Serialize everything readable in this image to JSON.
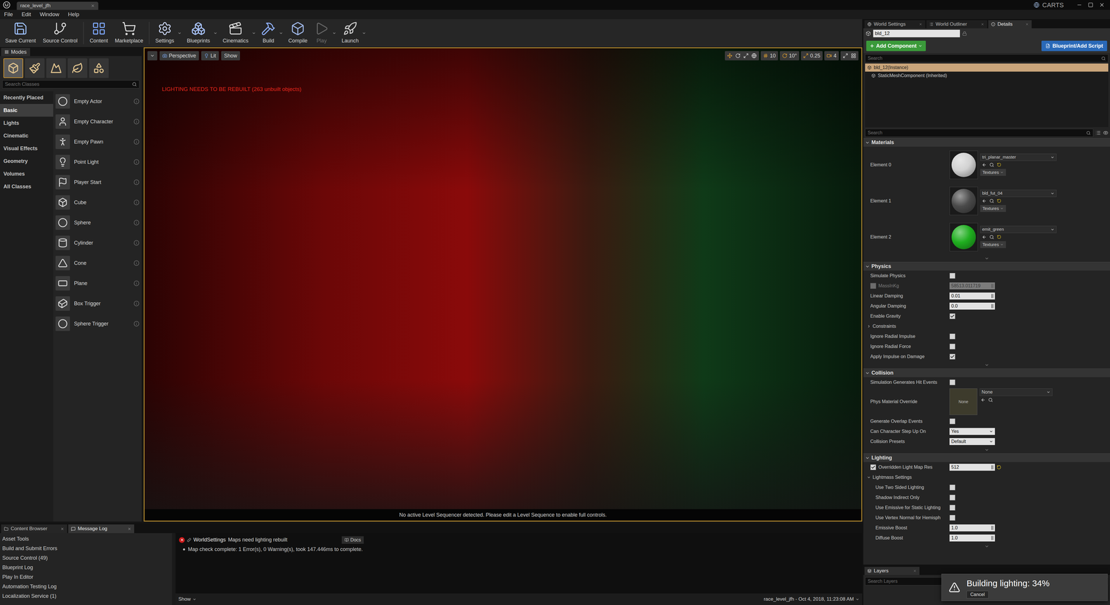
{
  "window": {
    "title": "race_level_jfh",
    "project": "CARTS"
  },
  "menu": [
    "File",
    "Edit",
    "Window",
    "Help"
  ],
  "toolbar": [
    {
      "label": "Save Current",
      "dropdown": false,
      "disabled": false,
      "separator_before": false
    },
    {
      "label": "Source Control",
      "dropdown": false,
      "disabled": false,
      "separator_before": false
    },
    {
      "label": "Content",
      "dropdown": false,
      "disabled": false,
      "separator_before": true
    },
    {
      "label": "Marketplace",
      "dropdown": false,
      "disabled": false,
      "separator_before": false
    },
    {
      "label": "Settings",
      "dropdown": true,
      "disabled": false,
      "separator_before": true
    },
    {
      "label": "Blueprints",
      "dropdown": true,
      "disabled": false,
      "separator_before": false
    },
    {
      "label": "Cinematics",
      "dropdown": true,
      "disabled": false,
      "separator_before": false
    },
    {
      "label": "Build",
      "dropdown": true,
      "disabled": false,
      "separator_before": false
    },
    {
      "label": "Compile",
      "dropdown": false,
      "disabled": false,
      "separator_before": false
    },
    {
      "label": "Play",
      "dropdown": true,
      "disabled": true,
      "separator_before": false
    },
    {
      "label": "Launch",
      "dropdown": true,
      "disabled": false,
      "separator_before": false
    }
  ],
  "modes": {
    "tab": "Modes",
    "tools": [
      {
        "selected": true
      },
      {
        "selected": false
      },
      {
        "selected": false
      },
      {
        "selected": false
      },
      {
        "selected": false
      }
    ],
    "search": {
      "placeholder": "Search Classes"
    },
    "categories": [
      {
        "label": "Recently Placed",
        "selected": false
      },
      {
        "label": "Basic",
        "selected": true
      },
      {
        "label": "Lights",
        "selected": false
      },
      {
        "label": "Cinematic",
        "selected": false
      },
      {
        "label": "Visual Effects",
        "selected": false
      },
      {
        "label": "Geometry",
        "selected": false
      },
      {
        "label": "Volumes",
        "selected": false
      },
      {
        "label": "All Classes",
        "selected": false
      }
    ],
    "items": [
      "Empty Actor",
      "Empty Character",
      "Empty Pawn",
      "Point Light",
      "Player Start",
      "Cube",
      "Sphere",
      "Cylinder",
      "Cone",
      "Plane",
      "Box Trigger",
      "Sphere Trigger"
    ]
  },
  "viewport": {
    "view": "Perspective",
    "lighting": "Lit",
    "show": "Show",
    "snap": [
      "10",
      "10°",
      "0.25",
      "4"
    ],
    "warning": "LIGHTING NEEDS TO BE REBUILT (263 unbuilt objects)",
    "footer": "No active Level Sequencer detected. Please edit a Level Sequence to enable full controls."
  },
  "bottom": {
    "tabs": [
      {
        "label": "Content Browser",
        "selected": false
      },
      {
        "label": "Message Log",
        "selected": true
      }
    ],
    "sources": [
      "Asset Tools",
      "Build and Submit Errors",
      "Source Control (49)",
      "Blueprint Log",
      "Play In Editor",
      "Automation Testing Log",
      "Localization Service (1)"
    ],
    "messages": [
      {
        "kind": "error",
        "source": "WorldSettings",
        "text": "Maps need lighting rebuilt",
        "docs": "Docs"
      },
      {
        "kind": "info",
        "source": "",
        "text": "Map check complete: 1 Error(s), 0 Warning(s), took 147.446ms to complete.",
        "docs": ""
      }
    ],
    "show": "Show",
    "status": "race_level_jfh - Oct 4, 2018, 11:23:08 AM"
  },
  "details": {
    "tabs": [
      {
        "label": "World Settings",
        "selected": false
      },
      {
        "label": "World Outliner",
        "selected": false
      },
      {
        "label": "Details",
        "selected": true
      }
    ],
    "name": "bld_12",
    "add_component": "Add Component",
    "blueprint": "Blueprint/Add Script",
    "component_search": {
      "placeholder": "Search"
    },
    "components": [
      {
        "label": "bld_12(Instance)",
        "selected": true
      },
      {
        "label": "StaticMeshComponent (Inherited)",
        "selected": false
      }
    ],
    "property_search": {
      "placeholder": "Search"
    },
    "materials": {
      "title": "Materials",
      "elements": [
        {
          "label": "Element 0",
          "material": "tri_planar_master",
          "textures": "Textures",
          "color": "#d2d2d2",
          "modified": true
        },
        {
          "label": "Element 1",
          "material": "bld_fut_04",
          "textures": "Textures",
          "color": "#4a4a4a",
          "modified": true
        },
        {
          "label": "Element 2",
          "material": "emit_green",
          "textures": "Textures",
          "color": "#1fae1f",
          "modified": true
        }
      ]
    },
    "sections": [
      {
        "title": "Physics",
        "rows": [
          {
            "kind": "check",
            "label": "Simulate Physics",
            "checked": false,
            "nested": false
          },
          {
            "kind": "number",
            "label": "MassInKg",
            "value": "58513.011719",
            "disabled": true,
            "has_check": true,
            "checked": false,
            "modified": false,
            "nested": false
          },
          {
            "kind": "number",
            "label": "Linear Damping",
            "value": "0.01",
            "disabled": false,
            "has_check": false,
            "checked": false,
            "modified": false,
            "nested": false
          },
          {
            "kind": "number",
            "label": "Angular Damping",
            "value": "0.0",
            "disabled": false,
            "has_check": false,
            "checked": false,
            "modified": false,
            "nested": false
          },
          {
            "kind": "check",
            "label": "Enable Gravity",
            "checked": true,
            "nested": false
          },
          {
            "kind": "group",
            "label": "Constraints",
            "expanded": false
          },
          {
            "kind": "check",
            "label": "Ignore Radial Impulse",
            "checked": false,
            "nested": false
          },
          {
            "kind": "check",
            "label": "Ignore Radial Force",
            "checked": false,
            "nested": false
          },
          {
            "kind": "check",
            "label": "Apply Impulse on Damage",
            "checked": true,
            "nested": false
          }
        ]
      },
      {
        "title": "Collision",
        "rows": [
          {
            "kind": "check",
            "label": "Simulation Generates Hit Events",
            "checked": false,
            "nested": false
          },
          {
            "kind": "asset",
            "label": "Phys Material Override",
            "thumb": "None",
            "value": "None"
          },
          {
            "kind": "check",
            "label": "Generate Overlap Events",
            "checked": false,
            "nested": false
          },
          {
            "kind": "select",
            "label": "Can Character Step Up On",
            "value": "Yes"
          },
          {
            "kind": "select",
            "label": "Collision Presets",
            "value": "Default"
          }
        ]
      },
      {
        "title": "Lighting",
        "rows": [
          {
            "kind": "number",
            "label": "Overridden Light Map Res",
            "value": "512",
            "disabled": false,
            "has_check": true,
            "checked": true,
            "modified": true,
            "nested": false
          },
          {
            "kind": "group",
            "label": "Lightmass Settings",
            "expanded": true
          },
          {
            "kind": "check",
            "label": "Use Two Sided Lighting",
            "checked": false,
            "nested": true
          },
          {
            "kind": "check",
            "label": "Shadow Indirect Only",
            "checked": false,
            "nested": true
          },
          {
            "kind": "check",
            "label": "Use Emissive for Static Lighting",
            "checked": false,
            "nested": true
          },
          {
            "kind": "check",
            "label": "Use Vertex Normal for Hemisph",
            "checked": false,
            "nested": true
          },
          {
            "kind": "number",
            "label": "Emissive Boost",
            "value": "1.0",
            "disabled": false,
            "has_check": false,
            "checked": false,
            "modified": false,
            "nested": true
          },
          {
            "kind": "number",
            "label": "Diffuse Boost",
            "value": "1.0",
            "disabled": false,
            "has_check": false,
            "checked": false,
            "modified": false,
            "nested": true
          }
        ]
      }
    ]
  },
  "layers": {
    "tab": "Layers",
    "search": {
      "placeholder": "Search Layers"
    }
  },
  "notification": {
    "text": "Building lighting: 34%",
    "button": "Cancel"
  }
}
